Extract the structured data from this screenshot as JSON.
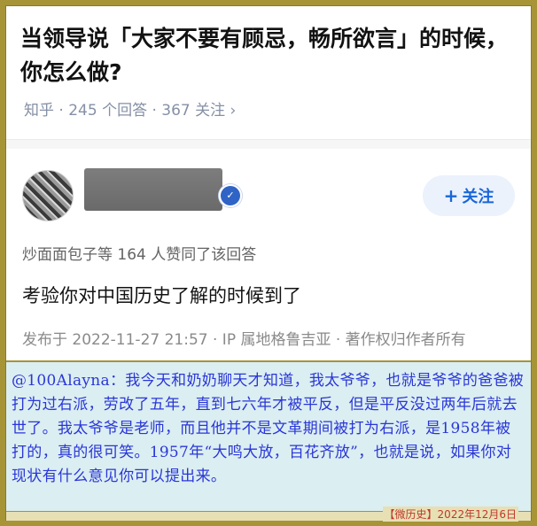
{
  "question": {
    "title": "当领导说「大家不要有顾忌，畅所欲言」的时候，你怎么做?",
    "meta": "知乎 · 245 个回答 · 367 关注 ›"
  },
  "answer": {
    "follow_label": "关注",
    "follow_icon": "plus-icon",
    "badge_icon": "verified-badge-icon",
    "upvoters": "炒面面包子等 164 人赞同了该回答",
    "text": "考验你对中国历史了解的时候到了",
    "published": "发布于 2022-11-27 21:57 · IP 属地格鲁吉亚 · 著作权归作者所有"
  },
  "comment": {
    "text": "@100Alayna：我今天和奶奶聊天才知道，我太爷爷，也就是爷爷的爸爸被打为过右派，劳改了五年，直到七六年才被平反，但是平反没过两年后就去世了。我太爷爷是老师，而且他并不是文革期间被打为右派，是1958年被打的，真的很可笑。1957年“大鸣大放，百花齐放”，也就是说，如果你对现状有什么意见你可以提出来。"
  },
  "footer": {
    "source": "【微历史】2022年12月6日"
  },
  "colors": {
    "border": "#a69436",
    "comment_bg": "#dbeef1",
    "comment_text": "#2a36d8",
    "follow_text": "#1966d9",
    "source_text": "#c0392b"
  }
}
